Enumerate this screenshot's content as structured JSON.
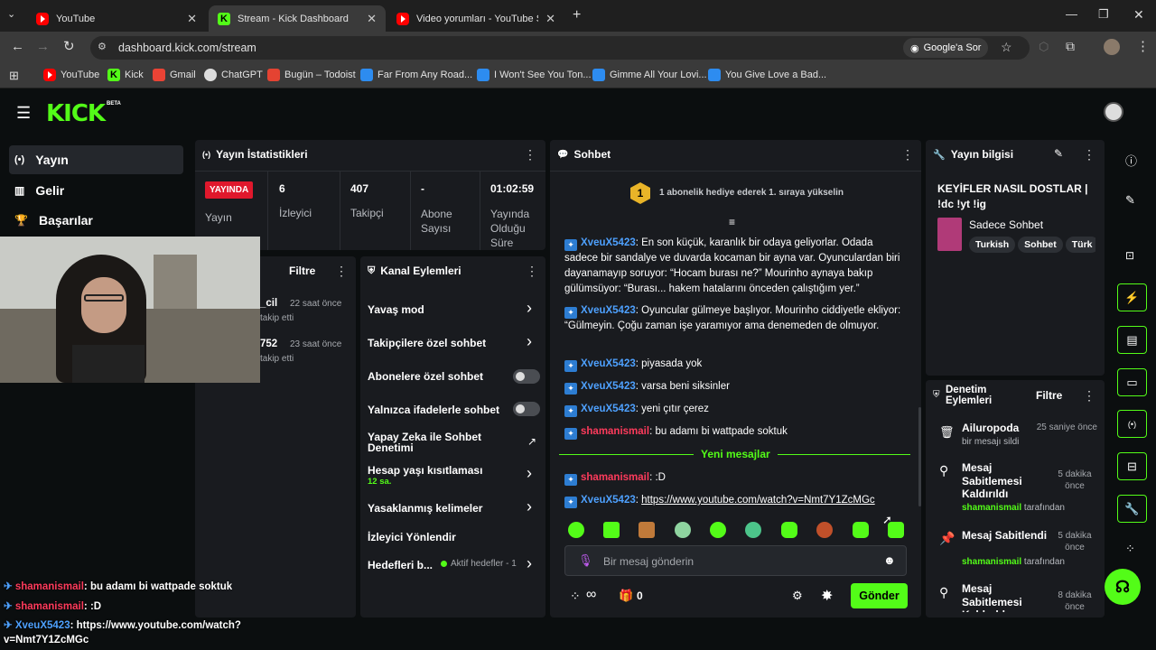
{
  "browser": {
    "tabs": [
      {
        "label": "YouTube"
      },
      {
        "label": "Stream - Kick Dashboard"
      },
      {
        "label": "Video yorumları - YouTube Stud"
      }
    ],
    "url": "dashboard.kick.com/stream",
    "lens_label": "Google'a Sor",
    "bookmarks": [
      "YouTube",
      "Kick",
      "Gmail",
      "ChatGPT",
      "Bugün – Todoist",
      "Far From Any Road...",
      "I Won't See You Ton...",
      "Gimme All Your Lovi...",
      "You Give Love a Bad..."
    ]
  },
  "brand": {
    "logo": "KICK",
    "beta": "BETA",
    "accent": "#53fc18"
  },
  "sidebar": {
    "items": [
      {
        "label": "Yayın",
        "icon": "broadcast-icon"
      },
      {
        "label": "Gelir",
        "icon": "chart-icon"
      },
      {
        "label": "Başarılar",
        "icon": "trophy-icon"
      }
    ]
  },
  "stats": {
    "title": "Yayın İstatistikleri",
    "live_badge": "YAYINDA",
    "live_label": "Yayın",
    "viewers_value": "6",
    "viewers_label": "İzleyici",
    "followers_value": "407",
    "followers_label": "Takipçi",
    "subs_value": "-",
    "subs_label": "Abone Sayısı",
    "duration_value": "01:02:59",
    "duration_label": "Yayında Olduğu Süre"
  },
  "activity": {
    "filter_label": "Filtre",
    "items": [
      {
        "name": "_cil",
        "time": "22 saat önce",
        "action": "takip etti"
      },
      {
        "name": "752",
        "time": "23 saat önce",
        "action": "takip etti"
      }
    ]
  },
  "channel_actions": {
    "title": "Kanal Eylemleri",
    "slow_mode": "Yavaş mod",
    "followers_only": "Takipçilere özel sohbet",
    "subs_only": "Abonelere özel sohbet",
    "emotes_only": "Yalnızca ifadelerle sohbet",
    "ai_moderation": "Yapay Zeka ile Sohbet Denetimi",
    "account_age": "Hesap yaşı kısıtlaması",
    "account_age_value": "12 sa.",
    "banned_words": "Yasaklanmış kelimeler",
    "raid": "İzleyici Yönlendir",
    "goals": "Hedefleri b...",
    "goals_status": "Aktif hedefler - 1"
  },
  "chat": {
    "title": "Sohbet",
    "gift_banner": "1 abonelik hediye ederek 1. sıraya yükselin",
    "gift_rank": "1",
    "messages": [
      {
        "user": "XveuX5423",
        "color": "blue",
        "text": ": En son küçük, karanlık bir odaya geliyorlar. Odada sadece bir sandalye ve duvarda kocaman bir ayna var. Oyunculardan biri dayanamayıp soruyor: “Hocam burası ne?” Mourinho aynaya bakıp gülümsüyor: “Burası... hakem hatalarını önceden çalıştığım yer.”"
      },
      {
        "user": "XveuX5423",
        "color": "blue",
        "text": ": Oyuncular gülmeye başlıyor. Mourinho ciddiyetle ekliyor: “Gülmeyin. Çoğu zaman işe yaramıyor ama denemeden de olmuyor."
      },
      {
        "user": "XveuX5423",
        "color": "blue",
        "text": ": piyasada yok"
      },
      {
        "user": "XveuX5423",
        "color": "blue",
        "text": ": varsa beni siksinler"
      },
      {
        "user": "XveuX5423",
        "color": "blue",
        "text": ": yeni çıtır çerez"
      },
      {
        "user": "shamanismail",
        "color": "red",
        "text": ": bu adamı bi wattpade soktuk"
      }
    ],
    "new_messages_label": "Yeni mesajlar",
    "new_messages": [
      {
        "user": "shamanismail",
        "color": "red",
        "text": ": :D"
      },
      {
        "user": "XveuX5423",
        "color": "blue",
        "text": ": ",
        "link": "https://www.youtube.com/watch?v=Nmt7Y1ZcMGc"
      }
    ],
    "input_placeholder": "Bir mesaj gönderin",
    "points": "∞",
    "gifts_count": "0",
    "send_label": "Gönder"
  },
  "stream_info": {
    "title": "Yayın bilgisi",
    "stream_title": "KEYİFLER NASIL DOSTLAR | !dc !yt !ig",
    "category": "Sadece Sohbet",
    "tags": [
      "Turkish",
      "Sohbet",
      "Türk"
    ]
  },
  "mod_log": {
    "title": "Denetim Eylemleri",
    "filter_label": "Filtre",
    "items": [
      {
        "icon": "trash-icon",
        "title": "Ailuropoda",
        "time": "25 saniye önce",
        "sub_name": "",
        "sub_text": "bir mesajı sildi"
      },
      {
        "icon": "unpin-icon",
        "title": "Mesaj Sabitlemesi Kaldırıldı",
        "time": "5 dakika önce",
        "sub_name": "shamanismail",
        "sub_text": " tarafından"
      },
      {
        "icon": "pin-icon",
        "title": "Mesaj Sabitlendi",
        "time": "5 dakika önce",
        "sub_name": "shamanismail",
        "sub_text": " tarafından"
      },
      {
        "icon": "unpin-icon",
        "title": "Mesaj Sabitlemesi Kaldırıldı",
        "time": "8 dakika önce",
        "sub_name": "",
        "sub_text": ""
      }
    ]
  },
  "overlay_chat": [
    {
      "user": "shamanismail",
      "color": "red",
      "text": " bu adamı bi wattpade soktuk"
    },
    {
      "user": "shamanismail",
      "color": "red",
      "text": " :D"
    },
    {
      "user": "XveuX5423",
      "color": "blue",
      "text": " https://www.youtube.com/watch?v=Nmt7Y1ZcMGc"
    }
  ]
}
